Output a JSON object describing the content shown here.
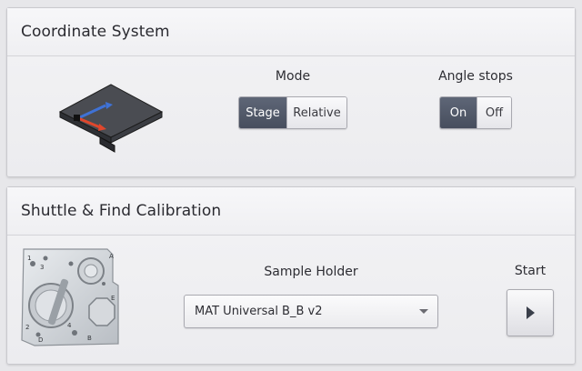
{
  "coordinate_panel": {
    "title": "Coordinate System",
    "mode": {
      "label": "Mode",
      "options": [
        "Stage",
        "Relative"
      ],
      "selected": "Stage"
    },
    "angle_stops": {
      "label": "Angle stops",
      "options": [
        "On",
        "Off"
      ],
      "selected": "On"
    },
    "stage_icon": "stage-axes-icon"
  },
  "shuttle_panel": {
    "title": "Shuttle & Find Calibration",
    "holder_image": "sample-holder-image",
    "sample_holder": {
      "label": "Sample Holder",
      "value": "MAT Universal B_B v2"
    },
    "start": {
      "label": "Start",
      "icon": "play-icon"
    },
    "holder_markings": [
      "1",
      "3",
      "A",
      "E",
      "2",
      "B",
      "4",
      "D"
    ]
  },
  "colors": {
    "active_segment": "#4d5464",
    "axis_blue": "#3f72d6",
    "axis_red": "#e0472c",
    "panel_bg": "#eeeef1"
  }
}
